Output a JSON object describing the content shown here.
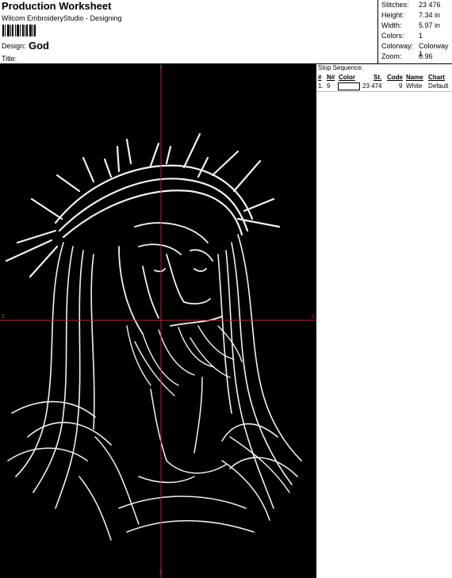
{
  "header": {
    "title": "Production Worksheet",
    "subtitle": "Wilcom EmbroideryStudio - Designing",
    "design_label": "Design:",
    "design_name": "God",
    "title_label": "Title:"
  },
  "stats": [
    {
      "label": "Stitches:",
      "value": "23 476"
    },
    {
      "label": "Height:",
      "value": "7.34 in"
    },
    {
      "label": "Width:",
      "value": "5.97 in"
    },
    {
      "label": "Colors:",
      "value": "1"
    },
    {
      "label": "Colorway:",
      "value": "Colorway 1"
    },
    {
      "label": "Zoom:",
      "value": "0.96"
    }
  ],
  "canvas": {
    "background": "#000000",
    "crosshair_color": "#c0262b",
    "marker_color_top": "#3aa84a",
    "markers": {
      "top": "1",
      "bottom": "2",
      "left": "1",
      "right": "2"
    }
  },
  "stop_sequence": {
    "heading": "Stop Sequence:",
    "columns": [
      "#",
      "N#",
      "Color",
      "St.",
      "Code",
      "Name",
      "Chart"
    ],
    "rows": [
      {
        "num": "1.",
        "n": "9",
        "color": "#ffffff",
        "stitches": "23 474",
        "code": "9",
        "name": "White",
        "chart": "Default"
      }
    ]
  }
}
